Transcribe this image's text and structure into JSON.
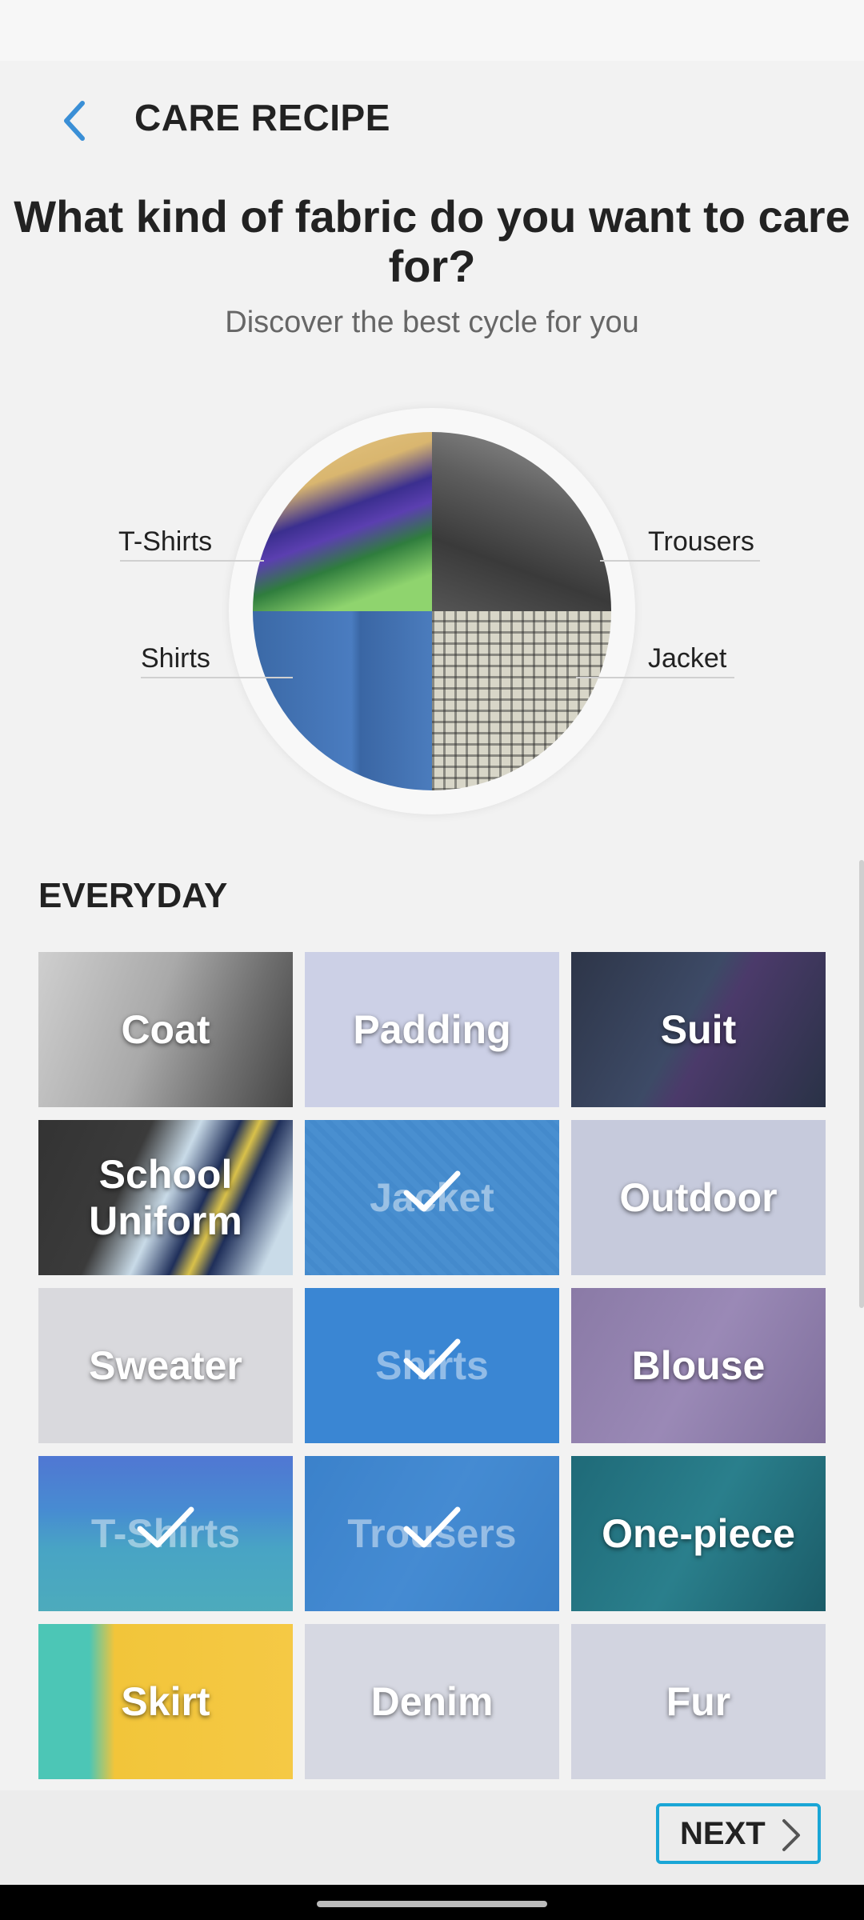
{
  "header": {
    "title": "CARE RECIPE",
    "back_icon": "chevron-left-icon"
  },
  "intro": {
    "question": "What kind of fabric do you want to care for?",
    "subtitle": "Discover the best cycle for you"
  },
  "pie": {
    "top_left": "T-Shirts",
    "top_right": "Trousers",
    "bottom_left": "Shirts",
    "bottom_right": "Jacket"
  },
  "section": {
    "title": "EVERYDAY"
  },
  "tiles": [
    {
      "label": "Coat",
      "selected": false
    },
    {
      "label": "Padding",
      "selected": false
    },
    {
      "label": "Suit",
      "selected": false
    },
    {
      "label": "School Uniform",
      "selected": false
    },
    {
      "label": "Jacket",
      "selected": true
    },
    {
      "label": "Outdoor",
      "selected": false
    },
    {
      "label": "Sweater",
      "selected": false
    },
    {
      "label": "Shirts",
      "selected": true
    },
    {
      "label": "Blouse",
      "selected": false
    },
    {
      "label": "T-Shirts",
      "selected": true
    },
    {
      "label": "Trousers",
      "selected": true
    },
    {
      "label": "One-piece",
      "selected": false
    },
    {
      "label": "Skirt",
      "selected": false
    },
    {
      "label": "Denim",
      "selected": false
    },
    {
      "label": "Fur",
      "selected": false
    }
  ],
  "footer": {
    "next_label": "NEXT",
    "next_icon": "chevron-right-icon"
  },
  "colors": {
    "accent": "#1aa6d6",
    "back_arrow": "#3a8fd6",
    "selected_overlay": "#3d86d6"
  }
}
